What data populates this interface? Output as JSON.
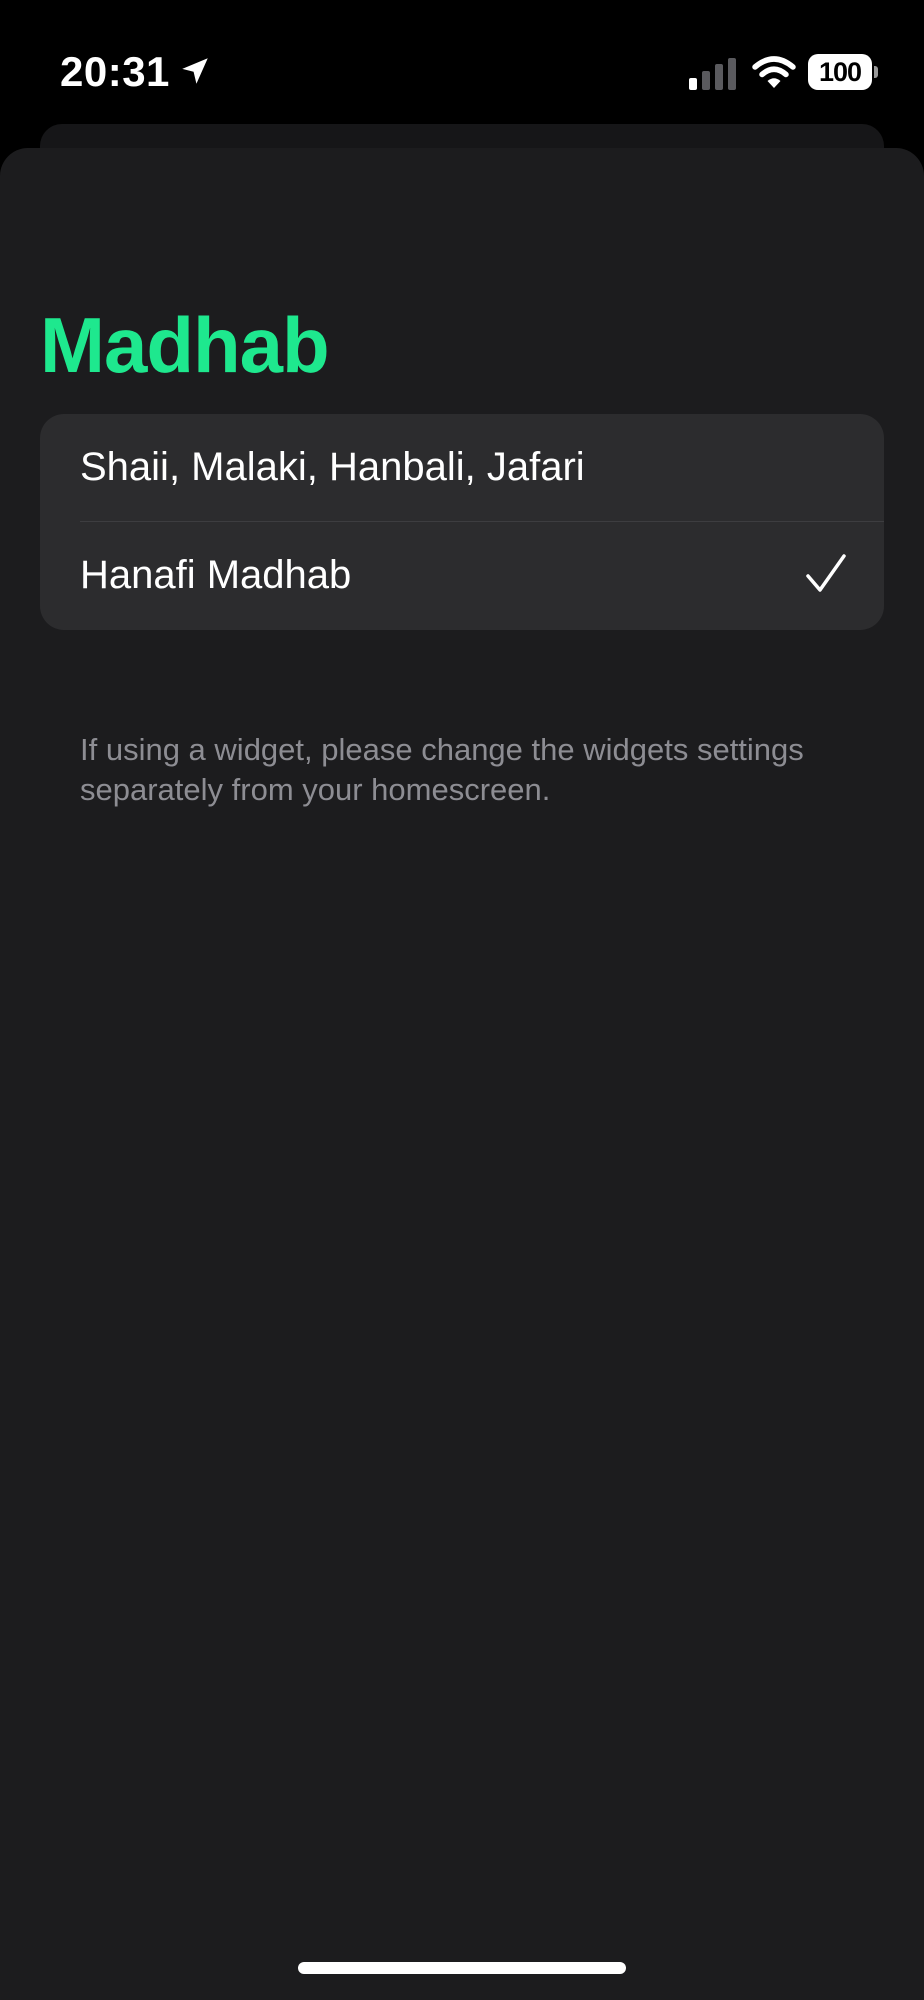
{
  "status_bar": {
    "time": "20:31",
    "battery_level": "100",
    "icons": [
      "location-arrow-icon",
      "cellular-signal-icon",
      "wifi-icon",
      "battery-icon"
    ]
  },
  "page": {
    "title": "Madhab",
    "accent_color": "#1ee88e",
    "options": [
      {
        "label": "Shaii, Malaki, Hanbali, Jafari",
        "selected": false
      },
      {
        "label": "Hanafi Madhab",
        "selected": true
      }
    ],
    "footer_note": "If using a widget, please change the widgets settings separately from your homescreen."
  },
  "colors": {
    "background": "#000000",
    "sheet": "#1c1c1e",
    "group": "#2c2c2e",
    "secondary_text": "#8d8d93"
  }
}
